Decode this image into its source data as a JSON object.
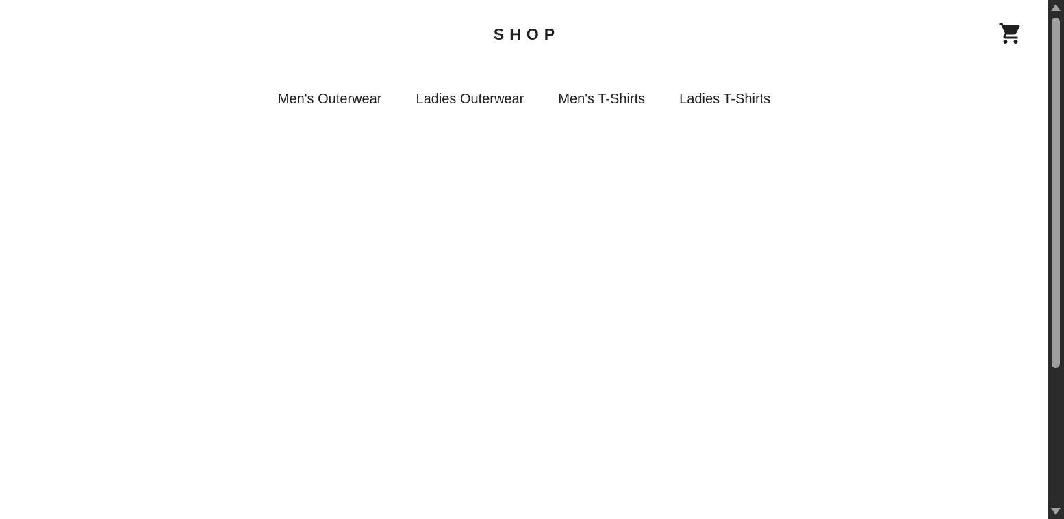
{
  "header": {
    "logo": "SHOP",
    "cart_icon": "cart-icon"
  },
  "nav": {
    "items": [
      {
        "label": "Men's Outerwear"
      },
      {
        "label": "Ladies Outerwear"
      },
      {
        "label": "Men's T-Shirts"
      },
      {
        "label": "Ladies T-Shirts"
      }
    ]
  },
  "colors": {
    "text": "#202020",
    "background": "#ffffff",
    "scrollbar_track": "#2b2b2b",
    "scrollbar_thumb": "#9f9f9f"
  }
}
